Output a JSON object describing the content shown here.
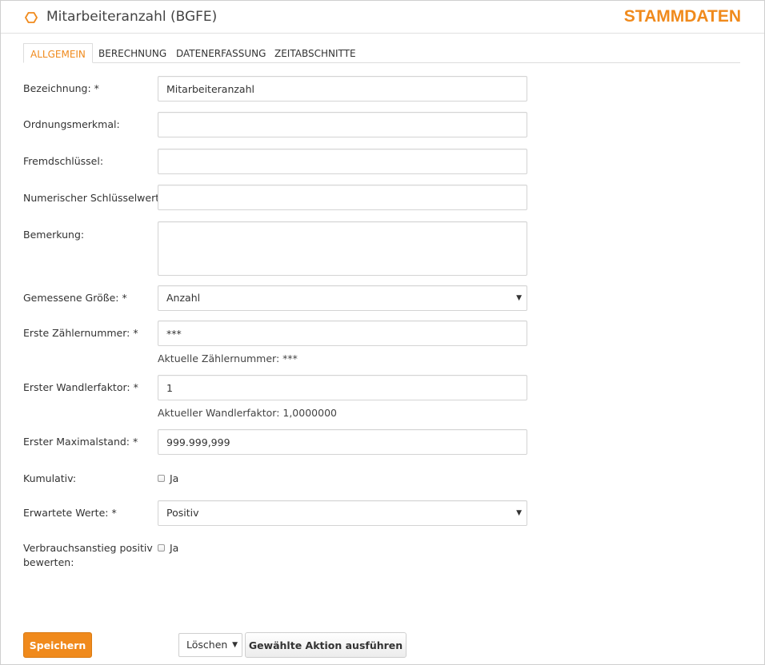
{
  "header": {
    "title": "Mitarbeiteranzahl (BGFE)",
    "brand": "STAMMDATEN",
    "icon": "hexagon-icon",
    "accent_color": "#f08a1c"
  },
  "tabs": [
    {
      "label": "ALLGEMEIN",
      "active": true
    },
    {
      "label": "BERECHNUNG",
      "active": false
    },
    {
      "label": "DATENERFASSUNG",
      "active": false
    },
    {
      "label": "ZEITABSCHNITTE",
      "active": false
    }
  ],
  "form": {
    "bezeichnung": {
      "label": "Bezeichnung: *",
      "value": "Mitarbeiteranzahl"
    },
    "ordnungsmerkmal": {
      "label": "Ordnungsmerkmal:",
      "value": ""
    },
    "fremdschluessel": {
      "label": "Fremdschlüssel:",
      "value": ""
    },
    "numerischer": {
      "label": "Numerischer Schlüsselwert:",
      "value": ""
    },
    "bemerkung": {
      "label": "Bemerkung:",
      "value": ""
    },
    "groesse": {
      "label": "Gemessene Größe: *",
      "value": "Anzahl"
    },
    "zaehlernummer": {
      "label": "Erste Zählernummer: *",
      "value": "***",
      "help": "Aktuelle Zählernummer: ***"
    },
    "wandlerfaktor": {
      "label": "Erster Wandlerfaktor: *",
      "value": "1",
      "help": "Aktueller Wandlerfaktor: 1,0000000"
    },
    "maximalstand": {
      "label": "Erster Maximalstand: *",
      "value": "999.999,999"
    },
    "kumulativ": {
      "label": "Kumulativ:",
      "checkbox_label": "Ja"
    },
    "erwartete": {
      "label": "Erwartete Werte: *",
      "value": "Positiv"
    },
    "verbrauch": {
      "label_line1": "Verbrauchsanstieg positiv",
      "label_line2": "bewerten:",
      "checkbox_label": "Ja"
    }
  },
  "footer": {
    "save_label": "Speichern",
    "action_select_value": "Löschen",
    "action_button_label": "Gewählte Aktion ausführen"
  }
}
